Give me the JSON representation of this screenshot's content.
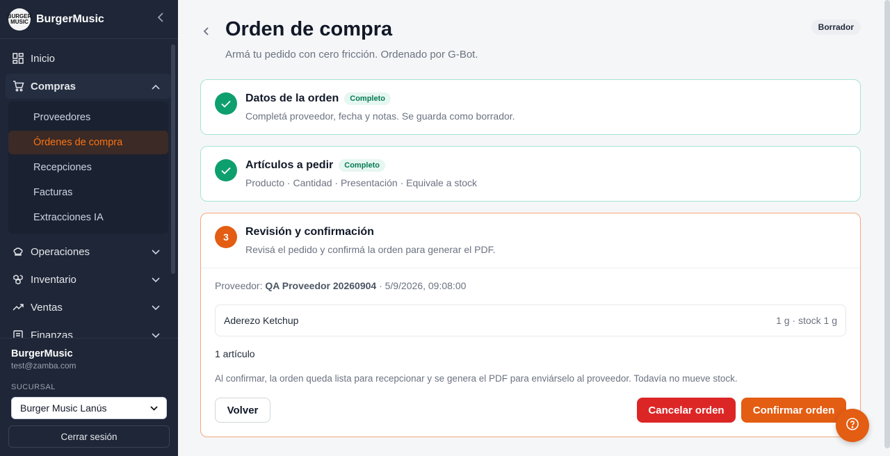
{
  "app": {
    "name": "BurgerMusic",
    "logo_text": "BURGER MUSIC"
  },
  "sidebar": {
    "items": [
      {
        "label": "Inicio",
        "icon": "grid-icon"
      },
      {
        "label": "Compras",
        "icon": "cart-icon",
        "expanded": true
      },
      {
        "label": "Operaciones",
        "icon": "chef-hat-icon"
      },
      {
        "label": "Inventario",
        "icon": "boxes-icon"
      },
      {
        "label": "Ventas",
        "icon": "trend-icon"
      },
      {
        "label": "Finanzas",
        "icon": "receipt-icon"
      }
    ],
    "compras_sub": [
      "Proveedores",
      "Órdenes de compra",
      "Recepciones",
      "Facturas",
      "Extracciones IA"
    ],
    "active_sub": "Órdenes de compra"
  },
  "user": {
    "name": "BurgerMusic",
    "email": "test@zamba.com"
  },
  "branch": {
    "label": "SUCURSAL",
    "selected": "Burger Music Lanús"
  },
  "logout_label": "Cerrar sesión",
  "page": {
    "title": "Orden de compra",
    "subtitle": "Armá tu pedido con cero fricción. Ordenado por G-Bot.",
    "status": "Borrador"
  },
  "steps": [
    {
      "title": "Datos de la orden",
      "badge": "Completo",
      "desc": "Completá proveedor, fecha y notas. Se guarda como borrador."
    },
    {
      "title": "Artículos a pedir",
      "badge": "Completo",
      "desc": "Producto · Cantidad · Presentación · Equivale a stock"
    },
    {
      "number": "3",
      "title": "Revisión y confirmación",
      "desc": "Revisá el pedido y confirmá la orden para generar el PDF."
    }
  ],
  "review": {
    "supplier_label": "Proveedor:",
    "supplier_name": "QA Proveedor 20260904",
    "datetime": "· 5/9/2026, 09:08:00",
    "item_name": "Aderezo Ketchup",
    "item_qty": "1 g · stock 1 g",
    "count": "1 artículo",
    "note": "Al confirmar, la orden queda lista para recepcionar y se genera el PDF para enviárselo al proveedor. Todavía no mueve stock.",
    "back_label": "Volver",
    "cancel_label": "Cancelar orden",
    "confirm_label": "Confirmar orden"
  },
  "colors": {
    "accent": "#e35d13",
    "success": "#0e9f6e",
    "danger": "#dc2626",
    "sidebar_bg": "#1e2637"
  }
}
